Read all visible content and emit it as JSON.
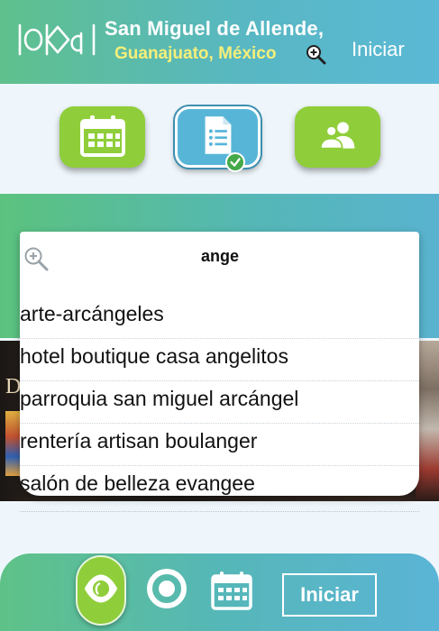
{
  "header": {
    "logo_text": "lokal",
    "location_line1": "San Miguel de Allende,",
    "location_line2": "Guanajuato, México",
    "login_label": "Iniciar"
  },
  "categories": [
    {
      "icon": "calendar-icon",
      "color": "#8fce3a",
      "active": false
    },
    {
      "icon": "document-list-icon",
      "color": "#57b6d8",
      "active": true
    },
    {
      "icon": "people-icon",
      "color": "#8fce3a",
      "active": false
    }
  ],
  "search": {
    "value": "ange",
    "results": [
      "arte-arcángeles",
      "hotel boutique casa angelitos",
      "parroquia san miguel arcángel",
      "rentería artisan boulanger",
      "salón de belleza evangee"
    ]
  },
  "banner": {
    "letter": "D"
  },
  "bottom_nav": {
    "items": [
      "eye-icon",
      "ring-icon",
      "calendar-icon"
    ],
    "login_label": "Iniciar"
  },
  "colors": {
    "accent_green": "#8fce3a",
    "accent_blue": "#57b6d8",
    "location_yellow": "#f5ef7a"
  }
}
